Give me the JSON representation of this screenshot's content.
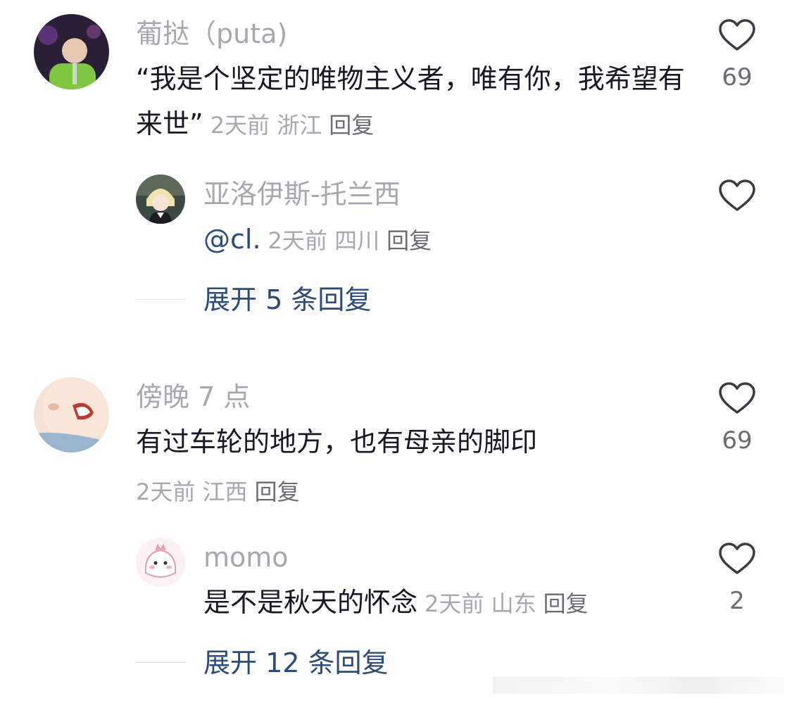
{
  "comments": [
    {
      "author": "葡挞（puta)",
      "text": "“我是个坚定的唯物主义者，唯有你，我希望有来世”",
      "time": "2天前",
      "location": "浙江",
      "reply_label": "回复",
      "likes": "69",
      "replies": [
        {
          "author": "亚洛伊斯-托兰西",
          "text": "@cl.",
          "time": "2天前",
          "location": "四川",
          "reply_label": "回复",
          "likes": ""
        }
      ],
      "expand_label": "展开 5 条回复"
    },
    {
      "author": "傍晚 7 点",
      "text": "有过车轮的地方，也有母亲的脚印",
      "time": "2天前",
      "location": "江西",
      "reply_label": "回复",
      "likes": "69",
      "replies": [
        {
          "author": "momo",
          "text": "是不是秋天的怀念",
          "time": "2天前",
          "location": "山东",
          "reply_label": "回复",
          "likes": "2"
        }
      ],
      "expand_label": "展开 12 条回复"
    }
  ],
  "icons": {
    "like": "heart-outline-icon"
  },
  "colors": {
    "text": "#161823",
    "muted": "#a7a8ad",
    "link": "#2c4a7a"
  }
}
